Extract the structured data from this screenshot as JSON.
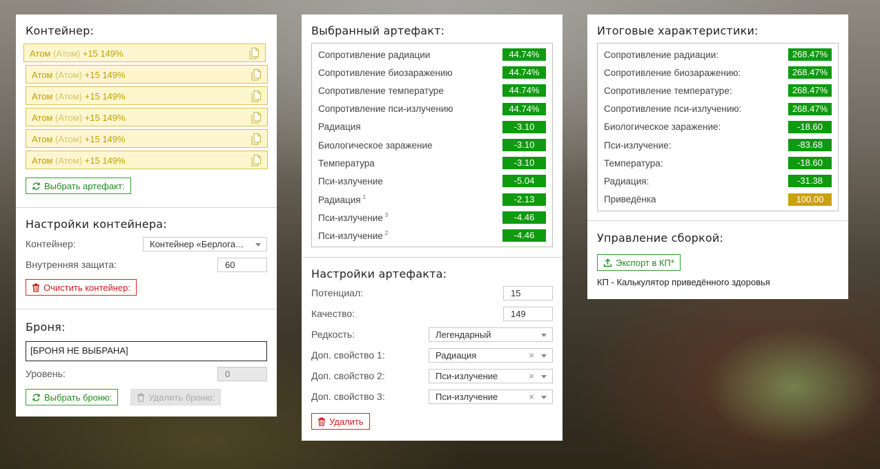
{
  "colors": {
    "accent_green": "#0f9a0f",
    "legendary_gold": "#c9a20e",
    "danger_red": "#cc1a1a",
    "artifact_yellow": "#c2a000"
  },
  "container_panel": {
    "title": "Контейнер:",
    "artifacts": [
      {
        "name": "Атом",
        "sub": "(Атом)",
        "stats": "+15 149%"
      },
      {
        "name": "Атом",
        "sub": "(Атом)",
        "stats": "+15 149%"
      },
      {
        "name": "Атом",
        "sub": "(Атом)",
        "stats": "+15 149%"
      },
      {
        "name": "Атом",
        "sub": "(Атом)",
        "stats": "+15 149%"
      },
      {
        "name": "Атом",
        "sub": "(Атом)",
        "stats": "+15 149%"
      },
      {
        "name": "Атом",
        "sub": "(Атом)",
        "stats": "+15 149%"
      }
    ],
    "select_artifact_label": "Выбрать артефакт:",
    "settings_title": "Настройки контейнера:",
    "container_label": "Контейнер:",
    "container_value": "Контейнер «Берлога…",
    "inner_protection_label": "Внутренняя защита:",
    "inner_protection_value": "60",
    "clear_label": "Очистить контейнер:",
    "armor_title": "Броня:",
    "armor_value": "[БРОНЯ НЕ ВЫБРАНА]",
    "level_label": "Уровень:",
    "level_value": "0",
    "select_armor_label": "Выбрать броню:",
    "remove_armor_label": "Удалить броню:"
  },
  "artifact_panel": {
    "title": "Выбранный артефакт:",
    "stats": [
      {
        "label": "Сопротивление радиации",
        "sup": "",
        "value": "44.74%"
      },
      {
        "label": "Сопротивление биозаражению",
        "sup": "",
        "value": "44.74%"
      },
      {
        "label": "Сопротивление температуре",
        "sup": "",
        "value": "44.74%"
      },
      {
        "label": "Сопротивление пси-излучению",
        "sup": "",
        "value": "44.74%"
      },
      {
        "label": "Радиация",
        "sup": "",
        "value": "-3.10"
      },
      {
        "label": "Биологическое заражение",
        "sup": "",
        "value": "-3.10"
      },
      {
        "label": "Температура",
        "sup": "",
        "value": "-3.10"
      },
      {
        "label": "Пси-излучение",
        "sup": "",
        "value": "-5.04"
      },
      {
        "label": "Радиация",
        "sup": "1",
        "value": "-2.13"
      },
      {
        "label": "Пси-излучение",
        "sup": "3",
        "value": "-4.46"
      },
      {
        "label": "Пси-излучение",
        "sup": "2",
        "value": "-4.46"
      }
    ],
    "settings_title": "Настройки артефакта:",
    "potential_label": "Потенциал:",
    "potential_value": "15",
    "quality_label": "Качество:",
    "quality_value": "149",
    "rarity_label": "Редкость:",
    "rarity_value": "Легендарный",
    "extra1_label": "Доп. свойство 1:",
    "extra1_value": "Радиация",
    "extra2_label": "Доп. свойство 2:",
    "extra2_value": "Пси-излучение",
    "extra3_label": "Доп. свойство 3:",
    "extra3_value": "Пси-излучение",
    "clear_symbol": "×",
    "delete_label": "Удалить"
  },
  "totals_panel": {
    "title": "Итоговые характеристики:",
    "stats": [
      {
        "label": "Сопротивление радиации:",
        "value": "268.47%",
        "color": "green"
      },
      {
        "label": "Сопротивление биозаражению:",
        "value": "268.47%",
        "color": "green"
      },
      {
        "label": "Сопротивление температуре:",
        "value": "268.47%",
        "color": "green"
      },
      {
        "label": "Сопротивление пси-излучению:",
        "value": "268.47%",
        "color": "green"
      },
      {
        "label": "Биологическое заражение:",
        "value": "-18.60",
        "color": "green"
      },
      {
        "label": "Пси-излучение:",
        "value": "-83.68",
        "color": "green"
      },
      {
        "label": "Температура:",
        "value": "-18.60",
        "color": "green"
      },
      {
        "label": "Радиация:",
        "value": "-31.38",
        "color": "green"
      },
      {
        "label": "Приведёнка",
        "value": "100.00",
        "color": "gold"
      }
    ],
    "manage_title": "Управление сборкой:",
    "export_label": "Экспорт в КП*",
    "footnote": "КП - Калькулятор приведённого здоровья"
  }
}
